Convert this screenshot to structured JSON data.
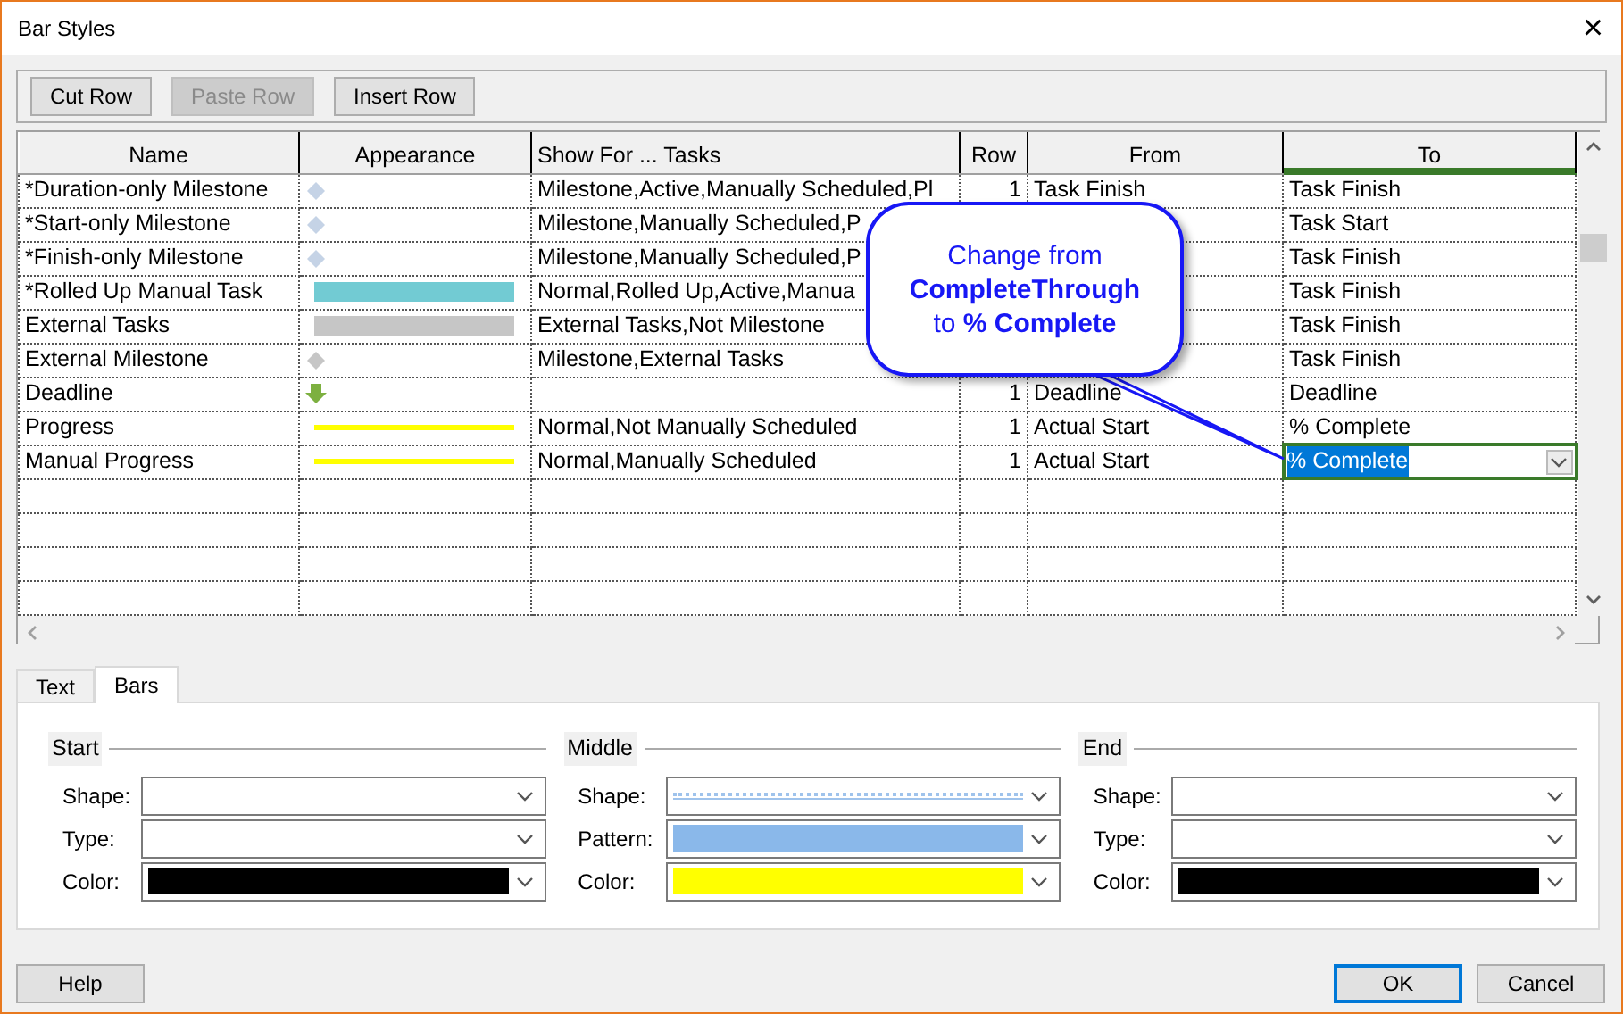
{
  "window": {
    "title": "Bar Styles",
    "close": "×"
  },
  "toolbar": [
    {
      "label": "Cut Row",
      "disabled": false
    },
    {
      "label": "Paste Row",
      "disabled": true
    },
    {
      "label": "Insert Row",
      "disabled": false
    }
  ],
  "table": {
    "columns": [
      {
        "label": "Name",
        "selected": false
      },
      {
        "label": "Appearance",
        "selected": false
      },
      {
        "label": "Show For ... Tasks",
        "selected": false
      },
      {
        "label": "Row",
        "selected": false
      },
      {
        "label": "From",
        "selected": false
      },
      {
        "label": "To",
        "selected": true
      }
    ],
    "rows": [
      {
        "name": "*Duration-only Milestone",
        "appearance": {
          "kind": "diamond",
          "color": "#c5d3e6"
        },
        "show_for": "Milestone,Active,Manually Scheduled,Pl",
        "row": "1",
        "from": "Task Finish",
        "to": "Task Finish",
        "editing": false
      },
      {
        "name": "*Start-only Milestone",
        "appearance": {
          "kind": "diamond",
          "color": "#c5d3e6"
        },
        "show_for": "Milestone,Manually Scheduled,P",
        "to": "Task Start",
        "editing": false
      },
      {
        "name": "*Finish-only Milestone",
        "appearance": {
          "kind": "diamond",
          "color": "#c5d3e6"
        },
        "show_for": "Milestone,Manually Scheduled,P",
        "to": "Task Finish",
        "editing": false
      },
      {
        "name": "*Rolled Up Manual Task",
        "appearance": {
          "kind": "bar",
          "color": "#72cbd3"
        },
        "show_for": "Normal,Rolled Up,Active,Manua",
        "to": "Task Finish",
        "editing": false
      },
      {
        "name": "External Tasks",
        "appearance": {
          "kind": "bar",
          "color": "#c6c6c6"
        },
        "show_for": "External Tasks,Not Milestone",
        "to": "Task Finish",
        "editing": false
      },
      {
        "name": "External Milestone",
        "appearance": {
          "kind": "diamond",
          "color": "#c6c6c6"
        },
        "show_for": "Milestone,External Tasks",
        "to": "Task Finish",
        "editing": false
      },
      {
        "name": "Deadline",
        "appearance": {
          "kind": "arrow",
          "color": "#7db040"
        },
        "row": "1",
        "from": "Deadline",
        "to": "Deadline",
        "editing": false
      },
      {
        "name": "Progress",
        "appearance": {
          "kind": "line",
          "color": "#ffff00"
        },
        "show_for": "Normal,Not Manually Scheduled",
        "row": "1",
        "from": "Actual Start",
        "to": "% Complete",
        "editing": false
      },
      {
        "name": "Manual Progress",
        "appearance": {
          "kind": "line",
          "color": "#ffff00"
        },
        "show_for": "Normal,Manually Scheduled",
        "row": "1",
        "from": "Actual Start",
        "to": "% Complete",
        "editing": true
      }
    ]
  },
  "callout": {
    "lines": [
      "Change from",
      "**CompleteThrough**",
      "to **% Complete**"
    ]
  },
  "tabs": [
    {
      "label": "Text",
      "selected": false
    },
    {
      "label": "Bars",
      "selected": true
    }
  ],
  "groups": [
    {
      "title": "Start",
      "fields": [
        {
          "label": "Shape:",
          "kind": "empty"
        },
        {
          "label": "Type:",
          "kind": "empty"
        },
        {
          "label": "Color:",
          "kind": "color",
          "color": "#000000"
        }
      ]
    },
    {
      "title": "Middle",
      "fields": [
        {
          "label": "Shape:",
          "kind": "dotted",
          "color": "#9fc3ec"
        },
        {
          "label": "Pattern:",
          "kind": "color",
          "color": "#8ab8ea"
        },
        {
          "label": "Color:",
          "kind": "color",
          "color": "#ffff00"
        }
      ]
    },
    {
      "title": "End",
      "fields": [
        {
          "label": "Shape:",
          "kind": "empty"
        },
        {
          "label": "Type:",
          "kind": "empty"
        },
        {
          "label": "Color:",
          "kind": "color",
          "color": "#000000"
        }
      ]
    }
  ],
  "buttons": [
    {
      "label": "Help",
      "default": false
    },
    {
      "label": "OK",
      "default": true
    },
    {
      "label": "Cancel",
      "default": false
    }
  ]
}
